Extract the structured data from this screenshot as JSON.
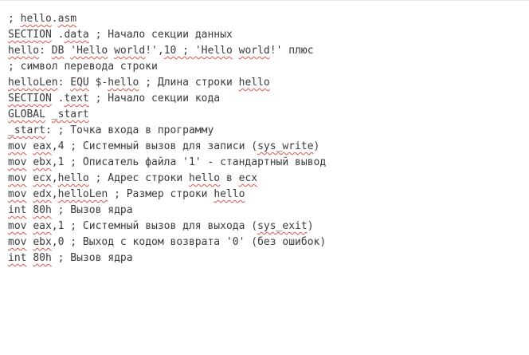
{
  "editor": {
    "lines": [
      [
        {
          "t": "; "
        },
        {
          "t": "hello",
          "s": 1
        },
        {
          "t": "."
        },
        {
          "t": "asm",
          "s": 1
        }
      ],
      [
        {
          "t": "SECTION",
          "s": 1
        },
        {
          "t": " ."
        },
        {
          "t": "data",
          "s": 1
        },
        {
          "t": " ; Начало секции данных"
        }
      ],
      [
        {
          "t": "hello",
          "s": 1
        },
        {
          "t": ": "
        },
        {
          "t": "DB",
          "s": 1
        },
        {
          "t": " "
        },
        {
          "t": "'Hello",
          "s": 1
        },
        {
          "t": " "
        },
        {
          "t": "world",
          "s": 1
        },
        {
          "t": "!',"
        },
        {
          "t": "10 ; 'Hello",
          "s": 1
        },
        {
          "t": " "
        },
        {
          "t": "world",
          "s": 1
        },
        {
          "t": "!' плюс"
        }
      ],
      [
        {
          "t": "; символ перевода строки"
        }
      ],
      [
        {
          "t": "helloLen",
          "s": 1
        },
        {
          "t": ": "
        },
        {
          "t": "EQU",
          "s": 1
        },
        {
          "t": " $-"
        },
        {
          "t": "hello",
          "s": 1
        },
        {
          "t": " ; Длина строки "
        },
        {
          "t": "hello",
          "s": 1
        }
      ],
      [
        {
          "t": "SECTION",
          "s": 1
        },
        {
          "t": " ."
        },
        {
          "t": "text",
          "s": 1
        },
        {
          "t": " ; Начало секции кода"
        }
      ],
      [
        {
          "t": "GLOBAL",
          "s": 1
        },
        {
          "t": " "
        },
        {
          "t": "_start",
          "s": 1
        }
      ],
      [
        {
          "t": "_start",
          "s": 1
        },
        {
          "t": ": ; Точка входа в программу"
        }
      ],
      [
        {
          "t": "mov",
          "s": 1
        },
        {
          "t": " "
        },
        {
          "t": "eax",
          "s": 1
        },
        {
          "t": ",4 ; Системный вызов для записи ("
        },
        {
          "t": "sys_write",
          "s": 1
        },
        {
          "t": ")"
        }
      ],
      [
        {
          "t": "mov",
          "s": 1
        },
        {
          "t": " "
        },
        {
          "t": "ebx",
          "s": 1
        },
        {
          "t": ",1 ; Описатель файла '1' - стандартный вывод"
        }
      ],
      [
        {
          "t": "mov",
          "s": 1
        },
        {
          "t": " "
        },
        {
          "t": "ecx",
          "s": 1
        },
        {
          "t": ","
        },
        {
          "t": "hello",
          "s": 1
        },
        {
          "t": " ; Адрес строки "
        },
        {
          "t": "hello",
          "s": 1
        },
        {
          "t": " в "
        },
        {
          "t": "ecx",
          "s": 1
        }
      ],
      [
        {
          "t": "mov",
          "s": 1
        },
        {
          "t": " "
        },
        {
          "t": "edx",
          "s": 1
        },
        {
          "t": ","
        },
        {
          "t": "helloLen",
          "s": 1
        },
        {
          "t": " ; Размер строки "
        },
        {
          "t": "hello",
          "s": 1
        }
      ],
      [
        {
          "t": "int",
          "s": 1
        },
        {
          "t": " "
        },
        {
          "t": "80h",
          "s": 1
        },
        {
          "t": " ; Вызов ядра"
        }
      ],
      [
        {
          "t": "mov",
          "s": 1
        },
        {
          "t": " "
        },
        {
          "t": "eax",
          "s": 1
        },
        {
          "t": ",1 ; Системный вызов для выхода ("
        },
        {
          "t": "sys_exit",
          "s": 1
        },
        {
          "t": ")"
        }
      ],
      [
        {
          "t": "mov",
          "s": 1
        },
        {
          "t": " "
        },
        {
          "t": "ebx",
          "s": 1
        },
        {
          "t": ",0 ; Выход с кодом возврата '0' (без ошибок)"
        }
      ],
      [
        {
          "t": "int",
          "s": 1
        },
        {
          "t": " "
        },
        {
          "t": "80h",
          "s": 1
        },
        {
          "t": " ; Вызов ядра"
        }
      ]
    ]
  }
}
